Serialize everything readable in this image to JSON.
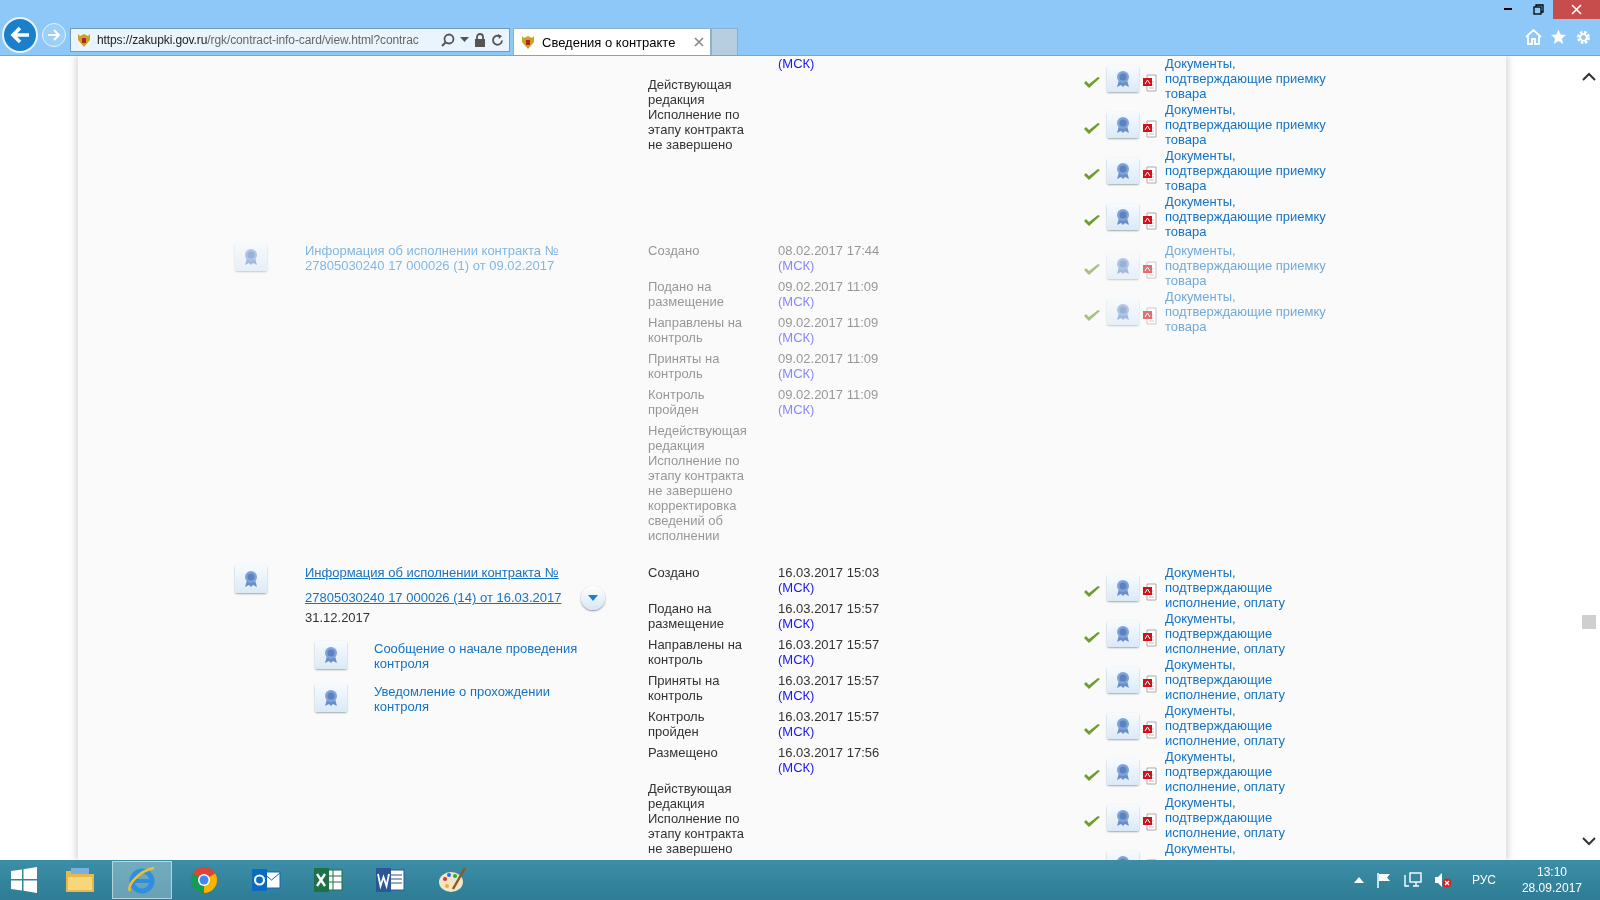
{
  "browser": {
    "url_host": "https://zakupki.gov.ru",
    "url_path": "/rgk/contract-info-card/view.html?contrac",
    "tabs": [
      {
        "title": "Сведения о контракте",
        "selected": true
      }
    ]
  },
  "sections": [
    {
      "active": true,
      "statuses": [
        {
          "tz": "(МСК)"
        }
      ],
      "note": "Действующая редакция Исполнение по этапу контракта не завершено",
      "docs": [
        {
          "text": "Документы, подтверждающие приемку товара"
        },
        {
          "text": "Документы, подтверждающие приемку товара"
        },
        {
          "text": "Документы, подтверждающие приемку товара"
        },
        {
          "text": "Документы, подтверждающие приемку товара"
        }
      ]
    },
    {
      "active": false,
      "title": "Информация об исполнении контракта № 27805030240 17 000026 (1) от 09.02.2017",
      "focused": false,
      "expandable": false,
      "statuses": [
        {
          "label": "Создано",
          "date": "08.02.2017 17:44",
          "tz": "(МСК)"
        },
        {
          "label": "Подано на размещение",
          "date": "09.02.2017 11:09",
          "tz": "(МСК)"
        },
        {
          "label": "Направлены на контроль",
          "date": "09.02.2017 11:09",
          "tz": "(МСК)"
        },
        {
          "label": "Приняты на контроль",
          "date": "09.02.2017 11:09",
          "tz": "(МСК)"
        },
        {
          "label": "Контроль пройден",
          "date": "09.02.2017 11:09",
          "tz": "(МСК)"
        }
      ],
      "note": "Недействующая редакция Исполнение по этапу контракта не завершено корректировка сведений об исполнении",
      "docs": [
        {
          "text": "Документы, подтверждающие приемку товара"
        },
        {
          "text": "Документы, подтверждающие приемку товара"
        }
      ]
    },
    {
      "active": true,
      "title": "Информация об исполнении контракта № 27805030240 17 000026 (14) от 16.03.2017",
      "focused": true,
      "expandable": true,
      "date": "31.12.2017",
      "children": [
        {
          "title": "Сообщение о начале проведения контроля"
        },
        {
          "title": "Уведомление о прохождении контроля"
        }
      ],
      "statuses": [
        {
          "label": "Создано",
          "date": "16.03.2017 15:03",
          "tz": "(МСК)"
        },
        {
          "label": "Подано на размещение",
          "date": "16.03.2017 15:57",
          "tz": "(МСК)"
        },
        {
          "label": "Направлены на контроль",
          "date": "16.03.2017 15:57",
          "tz": "(МСК)"
        },
        {
          "label": "Приняты на контроль",
          "date": "16.03.2017 15:57",
          "tz": "(МСК)"
        },
        {
          "label": "Контроль пройден",
          "date": "16.03.2017 15:57",
          "tz": "(МСК)"
        },
        {
          "label": "Размещено",
          "date": "16.03.2017 17:56",
          "tz": "(МСК)"
        }
      ],
      "note": "Действующая редакция Исполнение по этапу контракта не завершено",
      "docs": [
        {
          "text": "Документы, подтверждающие исполнение, оплату"
        },
        {
          "text": "Документы, подтверждающие исполнение, оплату"
        },
        {
          "text": "Документы, подтверждающие исполнение, оплату"
        },
        {
          "text": "Документы, подтверждающие исполнение, оплату"
        },
        {
          "text": "Документы, подтверждающие исполнение, оплату"
        },
        {
          "text": "Документы, подтверждающие исполнение, оплату"
        },
        {
          "text": "Документы,"
        }
      ]
    }
  ],
  "taskbar": {
    "apps": [
      {
        "kind": "explorer",
        "selected": false
      },
      {
        "kind": "ie",
        "selected": true
      },
      {
        "kind": "chrome",
        "selected": false
      },
      {
        "kind": "outlook",
        "selected": false
      },
      {
        "kind": "excel",
        "selected": false
      },
      {
        "kind": "word",
        "selected": false
      },
      {
        "kind": "paint",
        "selected": false
      }
    ],
    "language": "РУС",
    "time": "13:10",
    "date": "28.09.2017"
  }
}
